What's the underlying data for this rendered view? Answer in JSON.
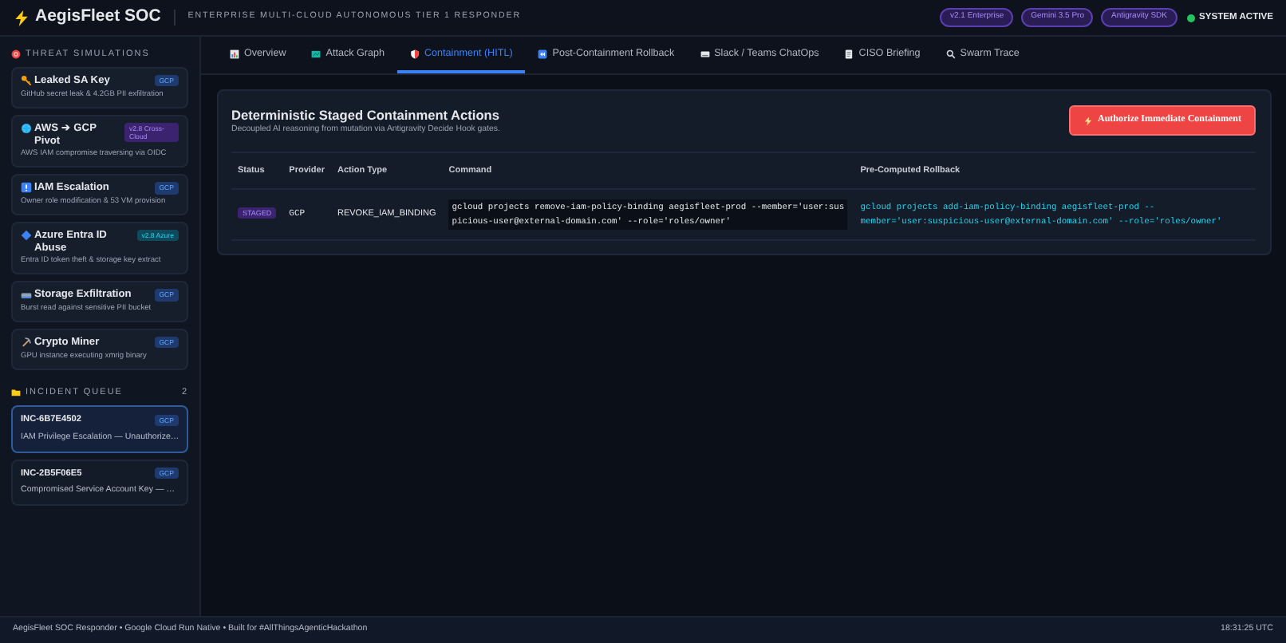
{
  "header": {
    "title": "AegisFleet SOC",
    "subtitle": "ENTERPRISE MULTI-CLOUD AUTONOMOUS TIER 1 RESPONDER",
    "badges": [
      "v2.1 Enterprise",
      "Gemini 3.5 Pro",
      "Antigravity SDK"
    ],
    "status": {
      "label": "SYSTEM ACTIVE",
      "active": true
    }
  },
  "sidebar": {
    "simulations_title": "THREAT SIMULATIONS",
    "simulations": [
      {
        "title": "Leaked SA Key",
        "badge": {
          "label": "GCP",
          "kind": "gcp"
        },
        "description": "GitHub secret leak & 4.2GB PII exfiltration"
      },
      {
        "title": "AWS ➔ GCP Pivot",
        "badge": {
          "label": "v2.8 Cross-Cloud",
          "kind": "cross"
        },
        "description": "AWS IAM compromise traversing via OIDC"
      },
      {
        "title": "IAM Escalation",
        "badge": {
          "label": "GCP",
          "kind": "gcp"
        },
        "description": "Owner role modification & 53 VM provision"
      },
      {
        "title": "Azure Entra ID Abuse",
        "badge": {
          "label": "v2.8 Azure",
          "kind": "azure"
        },
        "description": "Entra ID token theft & storage key extract"
      },
      {
        "title": "Storage Exfiltration",
        "badge": {
          "label": "GCP",
          "kind": "gcp"
        },
        "description": "Burst read against sensitive PII bucket"
      },
      {
        "title": "Crypto Miner",
        "badge": {
          "label": "GCP",
          "kind": "gcp"
        },
        "description": "GPU instance executing xmrig binary"
      }
    ],
    "queue_title": "INCIDENT QUEUE",
    "queue_count": "2",
    "incidents": [
      {
        "id": "INC-6B7E4502",
        "badge": "GCP",
        "summary": "IAM Privilege Escalation — Unauthorize…",
        "selected": true
      },
      {
        "id": "INC-2B5F06E5",
        "badge": "GCP",
        "summary": "Compromised Service Account Key — …",
        "selected": false
      }
    ]
  },
  "tabs": [
    {
      "label": "Overview",
      "selected": false
    },
    {
      "label": "Attack Graph",
      "selected": false
    },
    {
      "label": "Containment (HITL)",
      "selected": true
    },
    {
      "label": "Post-Containment Rollback",
      "selected": false
    },
    {
      "label": "Slack / Teams ChatOps",
      "selected": false
    },
    {
      "label": "CISO Briefing",
      "selected": false
    },
    {
      "label": "Swarm Trace",
      "selected": false
    }
  ],
  "panel": {
    "title": "Deterministic Staged Containment Actions",
    "subtitle": "Decoupled AI reasoning from mutation via Antigravity Decide Hook gates.",
    "action_button": "Authorize Immediate Containment",
    "table": {
      "columns": [
        "Status",
        "Provider",
        "Action Type",
        "Command",
        "Pre-Computed Rollback"
      ],
      "rows": [
        {
          "status": "STAGED",
          "provider": "GCP",
          "action_type": "REVOKE_IAM_BINDING",
          "command": "gcloud projects remove-iam-policy-binding aegisfleet-prod --member='user:suspicious-user@external-domain.com' --role='roles/owner'",
          "rollback": "gcloud projects add-iam-policy-binding aegisfleet-prod --member='user:suspicious-user@external-domain.com' --role='roles/owner'"
        }
      ]
    }
  },
  "footer": {
    "text": "AegisFleet SOC Responder • Google Cloud Run Native • Built for #AllThingsAgenticHackathon",
    "time": "18:31:25 UTC"
  }
}
